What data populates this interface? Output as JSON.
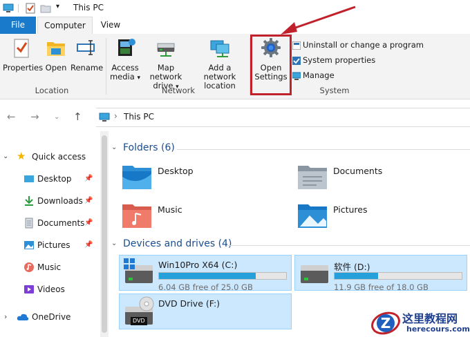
{
  "window": {
    "title": "This PC"
  },
  "tabs": {
    "file": "File",
    "computer": "Computer",
    "view": "View"
  },
  "ribbon": {
    "location": {
      "label": "Location",
      "properties": "Properties",
      "open": "Open",
      "rename": "Rename"
    },
    "network": {
      "label": "Network",
      "access_media_1": "Access",
      "access_media_2": "media",
      "map_drive_1": "Map network",
      "map_drive_2": "drive",
      "add_location_1": "Add a network",
      "add_location_2": "location"
    },
    "system": {
      "label": "System",
      "open_settings_1": "Open",
      "open_settings_2": "Settings",
      "uninstall": "Uninstall or change a program",
      "system_properties": "System properties",
      "manage": "Manage"
    }
  },
  "address": {
    "path": "This PC",
    "separator": "›"
  },
  "sidebar": {
    "quick_access": "Quick access",
    "items": [
      {
        "label": "Desktop",
        "pinned": true
      },
      {
        "label": "Downloads",
        "pinned": true
      },
      {
        "label": "Documents",
        "pinned": true
      },
      {
        "label": "Pictures",
        "pinned": true
      },
      {
        "label": "Music",
        "pinned": false
      },
      {
        "label": "Videos",
        "pinned": false
      }
    ],
    "onedrive": "OneDrive"
  },
  "folders": {
    "header": "Folders (6)",
    "items": [
      "Desktop",
      "Documents",
      "Music",
      "Pictures"
    ]
  },
  "drives": {
    "header": "Devices and drives (4)",
    "items": [
      {
        "name": "Win10Pro X64 (C:)",
        "free": "6.04 GB free of 25.0 GB",
        "used_fraction": 0.76
      },
      {
        "name": "软件 (D:)",
        "free": "11.9 GB free of 18.0 GB",
        "used_fraction": 0.34
      },
      {
        "name": "DVD Drive (F:)",
        "badge": "DVD"
      }
    ]
  },
  "watermark": {
    "title": "这里教程网",
    "url": "herecours.com",
    "letter": "Z"
  },
  "colors": {
    "accent": "#1979ca",
    "highlight": "#c0212b",
    "drive_fill": "#26a0da",
    "selection": "#cce8ff"
  }
}
